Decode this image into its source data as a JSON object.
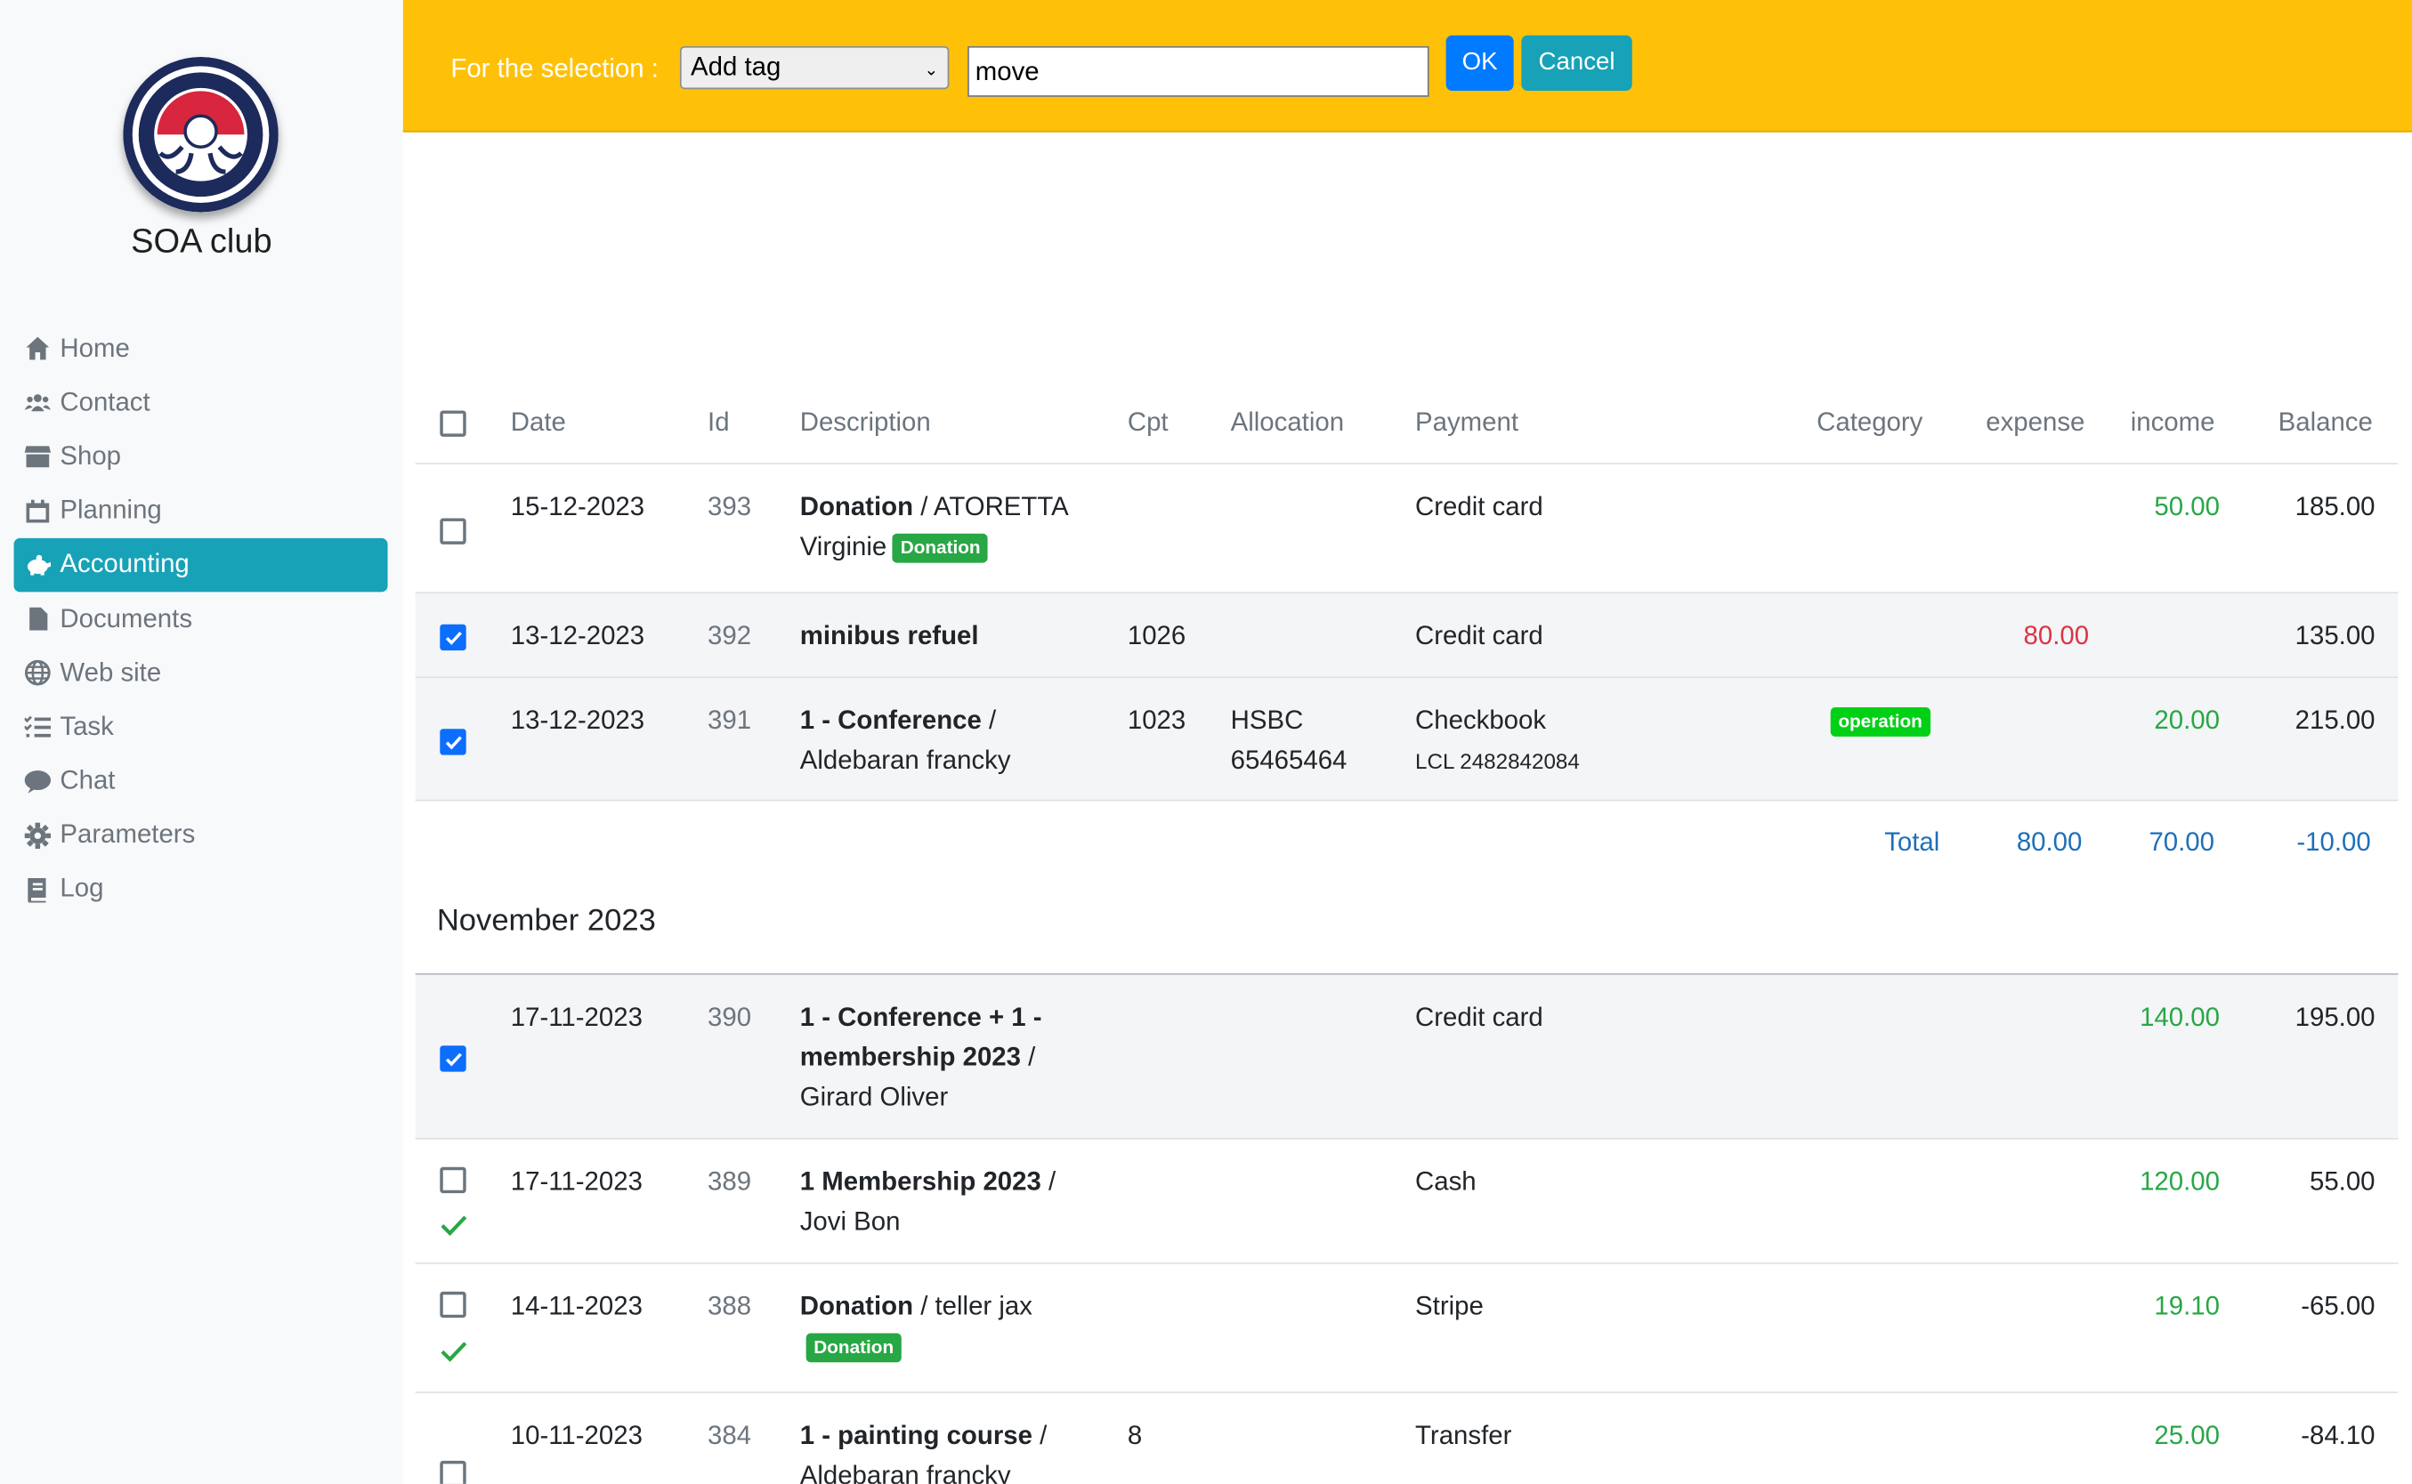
{
  "sidebar": {
    "club_name": "SOA club",
    "logo_alt": "club logo",
    "items": [
      {
        "label": "Home",
        "icon": "home-icon"
      },
      {
        "label": "Contact",
        "icon": "users-icon"
      },
      {
        "label": "Shop",
        "icon": "store-icon"
      },
      {
        "label": "Planning",
        "icon": "calendar-icon"
      },
      {
        "label": "Accounting",
        "icon": "piggy-bank-icon",
        "active": true
      },
      {
        "label": "Documents",
        "icon": "file-icon"
      },
      {
        "label": "Web site",
        "icon": "globe-icon"
      },
      {
        "label": "Task",
        "icon": "tasks-icon"
      },
      {
        "label": "Chat",
        "icon": "chat-icon"
      },
      {
        "label": "Parameters",
        "icon": "gear-icon"
      },
      {
        "label": "Log",
        "icon": "book-icon"
      }
    ]
  },
  "toolbar": {
    "label": "For the selection :",
    "action_selected": "Add tag",
    "tag_value": "move",
    "ok_label": "OK",
    "cancel_label": "Cancel"
  },
  "table": {
    "headers": {
      "date": "Date",
      "id": "Id",
      "description": "Description",
      "cpt": "Cpt",
      "allocation": "Allocation",
      "payment": "Payment",
      "category": "Category",
      "expense": "expense",
      "income": "income",
      "balance": "Balance"
    },
    "december_rows": [
      {
        "date": "15-12-2023",
        "id": "393",
        "desc_bold": "Donation",
        "desc_rest": " / ATORETTA Virginie",
        "badge": "Donation",
        "payment": "Credit card",
        "income": "50.00",
        "balance": "185.00",
        "checked": false
      },
      {
        "date": "13-12-2023",
        "id": "392",
        "desc_bold": "minibus refuel",
        "desc_rest": "",
        "cpt": "1026",
        "payment": "Credit card",
        "expense": "80.00",
        "balance": "135.00",
        "checked": true
      },
      {
        "date": "13-12-2023",
        "id": "391",
        "desc_bold": "1 - Conference",
        "desc_rest": " / Aldebaran francky",
        "cpt": "1023",
        "allocation": "HSBC 65465464",
        "payment": "Checkbook",
        "payment_sub": "LCL 2482842084",
        "category": "operation",
        "income": "20.00",
        "balance": "215.00",
        "checked": true
      }
    ],
    "totals": {
      "label": "Total",
      "expense": "80.00",
      "income": "70.00",
      "balance": "-10.00"
    },
    "month_heading": "November 2023",
    "november_rows": [
      {
        "date": "17-11-2023",
        "id": "390",
        "desc_bold": "1 - Conference + 1 - membership 2023",
        "desc_rest": " / Girard Oliver",
        "payment": "Credit card",
        "income": "140.00",
        "balance": "195.00",
        "checked": true
      },
      {
        "date": "17-11-2023",
        "id": "389",
        "desc_bold": "1 Membership 2023",
        "desc_rest": " / Jovi Bon",
        "payment": "Cash",
        "income": "120.00",
        "balance": "55.00",
        "checked": false,
        "validated": true
      },
      {
        "date": "14-11-2023",
        "id": "388",
        "desc_bold": "Donation",
        "desc_rest": " / teller jax",
        "badge": "Donation",
        "payment": "Stripe",
        "income": "19.10",
        "balance": "-65.00",
        "checked": false,
        "validated": true
      },
      {
        "date": "10-11-2023",
        "id": "384",
        "desc_bold": "1 - painting course",
        "desc_rest": " / Aldebaran francky",
        "cpt": "8",
        "payment": "Transfer",
        "income": "25.00",
        "balance": "-84.10",
        "checked": false
      }
    ]
  }
}
